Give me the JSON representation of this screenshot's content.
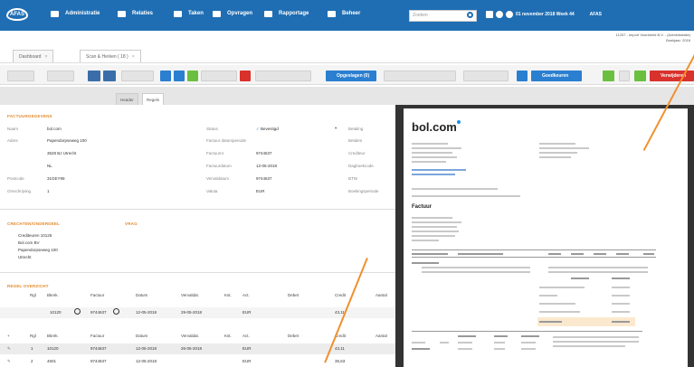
{
  "topbar": {
    "logo": "AFAS",
    "nav": [
      "Administratie",
      "Relaties",
      "Taken",
      "Opvragen",
      "Rapportage",
      "Beheer"
    ],
    "search_placeholder": "Zoeken",
    "datetime": "01 november 2018  Week 44",
    "user": "AFAS",
    "icons": [
      "folder-icon",
      "help-icon",
      "settings-icon"
    ]
  },
  "breadcrumb": {
    "line1": "11257 - Import Voorbeeld B.V. - (Administratie)",
    "line2": "Boekjaar: 2018"
  },
  "tabs": [
    {
      "label": "Dashboard"
    },
    {
      "label": "Scan & Herken ( 18 )"
    }
  ],
  "toolbar": {
    "button_opgeslagen": "Opgeslagen (0)",
    "button_goedkeuren": "Goedkeuren",
    "button_verwijderen": "Verwijderen"
  },
  "subtabs": [
    "Header",
    "Regels"
  ],
  "form": {
    "section_main": "FACTUURGEGEVENS",
    "labels_left": [
      "Naam",
      "Adres",
      "",
      "",
      "Postcode",
      "Omschrijving"
    ],
    "values_left": [
      "bol.com",
      "Papendorpseweg 100",
      "3528 BJ  Utrecht",
      "NL",
      "31GEY99",
      "1"
    ],
    "labels_mid": [
      "Status",
      "Factuur datumperiode",
      "Factuurnr",
      "Factuurdatum",
      "Vervaldatum",
      "Valuta"
    ],
    "values_mid": [
      "Bevestigd",
      "",
      "9744637",
      "12-05-2018",
      "9744637",
      "EUR"
    ],
    "labels_right": [
      "Betaling",
      "Betalen",
      "Crediteur",
      "Dagboekcode",
      "BTW",
      "Boekingsperiode"
    ],
    "section_address": "CRECHTEN/ONDERDEEL",
    "section_address_right": "VRAG",
    "address_lines": [
      "Crediteuren 10125",
      "Bol.com BV",
      "Papendorpseweg 100",
      "Utrecht"
    ],
    "section_lines": "REGEL OVERZICHT",
    "table_headers": [
      "Rgl",
      "Bkrek.",
      "Factuur",
      "Datum",
      "Vervaldat.",
      "Kst.",
      "Act.",
      "Debet",
      "Credit",
      "Aantal"
    ],
    "row_input": [
      "",
      "10120",
      "9744637",
      "12-05-2018",
      "29-05-2018",
      "",
      "EUR",
      "",
      "43,11",
      ""
    ],
    "rows": [
      [
        "1",
        "10120",
        "9744637",
        "12-05-2018",
        "26-05-2018",
        "",
        "EUR",
        "",
        "43,11",
        ""
      ],
      [
        "2",
        "4601",
        "9744637",
        "12-05-2018",
        "",
        "",
        "EUR",
        "",
        "35,63",
        ""
      ]
    ]
  },
  "invoice": {
    "brand": "bol.com",
    "title": "Factuur"
  },
  "colors": {
    "topbar": "#1f6eb3",
    "accent": "#e08a2e",
    "button_blue": "#2a7fd0",
    "button_red": "#d9312c",
    "button_green": "#6bbf3f"
  }
}
